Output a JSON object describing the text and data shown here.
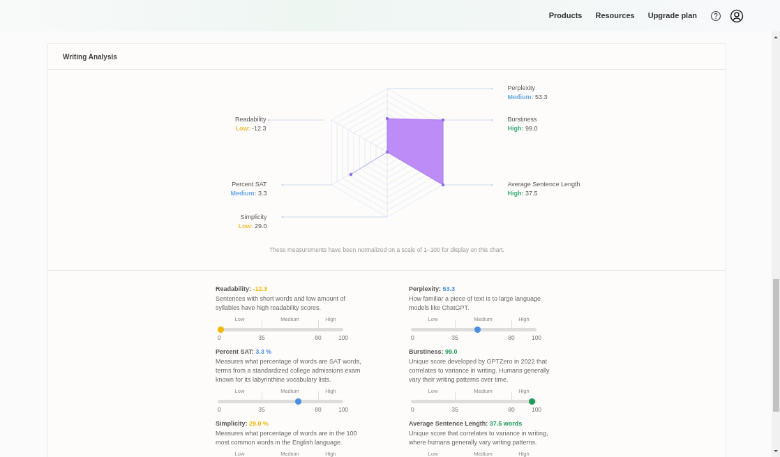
{
  "nav": {
    "links": [
      "Products",
      "Resources",
      "Upgrade plan"
    ]
  },
  "card": {
    "title": "Writing Analysis",
    "radar": {
      "axes": [
        {
          "name": "Perplexity",
          "color": "#6aa8e8",
          "rating_text": "Medium:",
          "value": "53.3"
        },
        {
          "name": "Readability",
          "color": "#f0c040",
          "rating_text": "Low:",
          "value": "-12.3"
        },
        {
          "name": "Burstiness",
          "color": "#3fb07a",
          "rating_text": "High:",
          "value": "99.0"
        },
        {
          "name": "Percent SAT",
          "color": "#6aa8e8",
          "rating_text": "Medium:",
          "value": "3.3"
        },
        {
          "name": "Average Sentence Length",
          "color": "#3fb07a",
          "rating_text": "High:",
          "value": "37.5"
        },
        {
          "name": "Simplicity",
          "color": "#f0c040",
          "rating_text": "Low:",
          "value": "29.0"
        }
      ],
      "note": "These measurements have been normalized on a scale of 1–100 for display on this chart."
    },
    "metrics": [
      {
        "title": "Readability:",
        "value": "-12.3",
        "color": "#f2b705",
        "description": "Sentences with short words and low amount of syllables have high readability scores.",
        "zones": [
          "Low",
          "Medium",
          "High"
        ],
        "ticks": [
          "0",
          "35",
          "80",
          "100"
        ],
        "level": 0
      },
      {
        "title": "Perplexity:",
        "value": "53.3",
        "color": "#4a90e2",
        "description": "How familiar a piece of text is to large language models like ChatGPT.",
        "zones": [
          "Low",
          "Medium",
          "High"
        ],
        "ticks": [
          "0",
          "35",
          "80",
          "100"
        ],
        "level": 0.53
      },
      {
        "title": "Percent SAT:",
        "value": "3.3 %",
        "color": "#4a90e2",
        "description": "Measures what percentage of words are SAT words, terms from a standardized college admissions exam known for its labyrinthine vocabulary lists.",
        "zones": [
          "Low",
          "Medium",
          "High"
        ],
        "ticks": [
          "0",
          "35",
          "80",
          "100"
        ],
        "level": 0.65
      },
      {
        "title": "Burstiness:",
        "value": "99.0",
        "color": "#1e9c5a",
        "description": "Unique score developed by GPTZero in 2022 that correlates to variance in writing. Humans generally vary their writing patterns over time.",
        "zones": [
          "Low",
          "Medium",
          "High"
        ],
        "ticks": [
          "0",
          "35",
          "80",
          "100"
        ],
        "level": 0.99
      },
      {
        "title": "Simplicity:",
        "value": "29.0 %",
        "color": "#f2b705",
        "description": "Measures what percentage of words are in the 100 most common words in the English language.",
        "zones": [
          "Low",
          "Medium",
          "High"
        ]
      },
      {
        "title": "Average Sentence Length:",
        "value": "37.5 words",
        "color": "#1e9c5a",
        "description": "Unique score that correlates to variance in writing, where humans generally vary writing patterns.",
        "zones": [
          "Low",
          "Medium",
          "High"
        ]
      }
    ]
  }
}
